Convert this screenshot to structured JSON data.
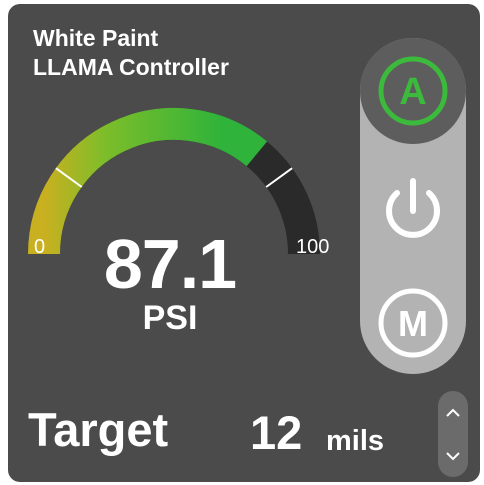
{
  "header": {
    "line1": "White Paint",
    "line2": "LLAMA Controller"
  },
  "gauge": {
    "min_label": "0",
    "max_label": "100",
    "value": "87.1",
    "unit": "PSI",
    "value_fraction": 0.72,
    "low_marker_fraction": 0.2,
    "high_marker_fraction": 0.8
  },
  "mode_buttons": {
    "auto_label": "A",
    "manual_label": "M",
    "power_icon": "power-icon",
    "active_mode": "auto"
  },
  "target": {
    "label": "Target",
    "value": "12",
    "unit": "mils"
  },
  "stepper": {
    "up_icon": "chevron-up-icon",
    "down_icon": "chevron-down-icon"
  },
  "colors": {
    "card_bg": "#4b4b4b",
    "rail_bg": "#b3b3b3",
    "active_button": "#5d5d5d",
    "accent_green": "#3cba3c",
    "gauge_track": "#2a2a2a",
    "gauge_low": "#c9b020"
  }
}
